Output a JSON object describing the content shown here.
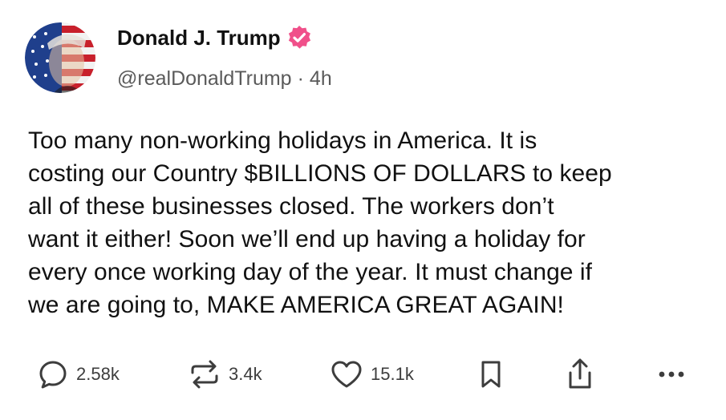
{
  "post": {
    "author": {
      "display_name": "Donald J. Trump",
      "handle": "@realDonaldTrump",
      "verified": true,
      "avatar": "avatar-flag-portrait"
    },
    "separator": "·",
    "time_ago": "4h",
    "text": "Too many non-working holidays in America. It is\ncosting our Country $BILLIONS OF DOLLARS to keep\nall of these businesses closed. The workers don’t\nwant it either! Soon we’ll end up having a holiday for\nevery once working day of the year. It must change if\nwe are going to, MAKE AMERICA GREAT AGAIN!"
  },
  "actions": {
    "reply": {
      "icon": "reply-icon",
      "count": "2.58k"
    },
    "repost": {
      "icon": "repost-icon",
      "count": "3.4k"
    },
    "like": {
      "icon": "heart-icon",
      "count": "15.1k"
    },
    "bookmark": {
      "icon": "bookmark-icon"
    },
    "share": {
      "icon": "share-icon"
    },
    "more": {
      "icon": "more-icon"
    }
  },
  "colors": {
    "verified_badge": "#f0508a",
    "text": "#111111",
    "secondary_text": "#5a5a5a",
    "icon": "#3d3d3d"
  }
}
